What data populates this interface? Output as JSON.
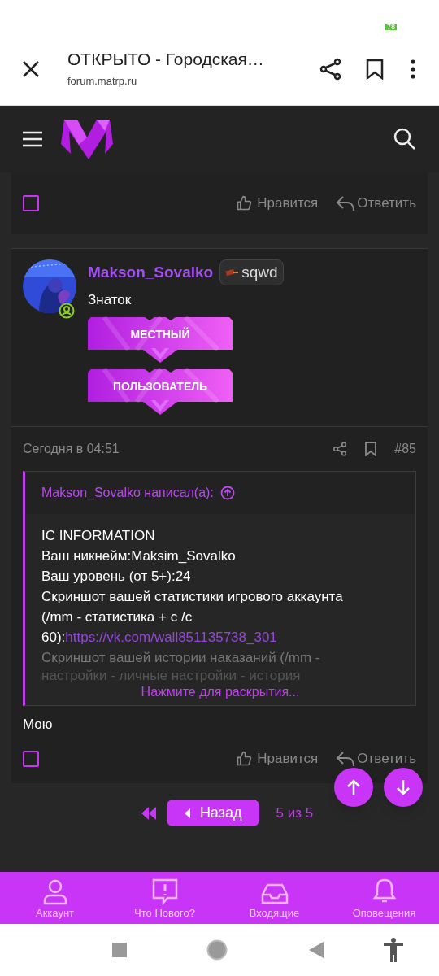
{
  "status_bar": {
    "battery": "78"
  },
  "browser": {
    "title": "ОТКРЫТО - Городская…",
    "url": "forum.matrp.ru"
  },
  "previous_post": {
    "checked": false,
    "like": "Нравится",
    "reply": "Ответить"
  },
  "post": {
    "author": "Makson_Sovalko",
    "badge": "sqwd",
    "user_title": "Знаток",
    "banners": [
      "МЕСТНЫЙ",
      "ПОЛЬЗОВАТЕЛЬ"
    ],
    "date": "Сегодня в 04:51",
    "number": "#85",
    "quote": {
      "header": "Makson_Sovalko написал(а):",
      "lines": [
        "IC INFORMATION",
        "Ваш никнейм:Maksim_Sovalko",
        "Ваш уровень (от 5+):24"
      ],
      "stat_text": "Скриншот вашей статистики игрового аккаунта (/mm - статистика + с /с 60):",
      "stat_link": "https://vk.com/wall851135738_301",
      "faded_line": "Скриншот вашей истории наказаний (/mm -",
      "faded_line_2": "настройки - личные настройки - история",
      "expand": "Нажмите для раскрытия..."
    },
    "body": "Мою",
    "checked": false,
    "like": "Нравится",
    "reply": "Ответить"
  },
  "pagination": {
    "back": "Назад",
    "page": "5 из 5"
  },
  "bottom_nav": [
    {
      "kind": "account",
      "label": "Аккаунт"
    },
    {
      "kind": "news",
      "label": "Что Нового?"
    },
    {
      "kind": "inbox",
      "label": "Входящие"
    },
    {
      "kind": "alerts",
      "label": "Оповещения"
    }
  ]
}
